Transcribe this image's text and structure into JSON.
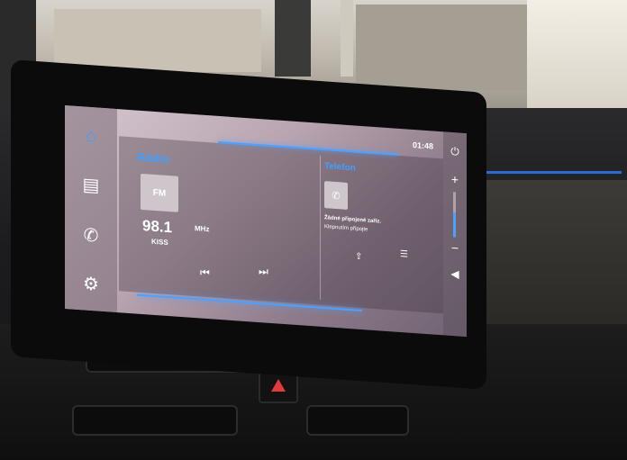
{
  "status": {
    "time": "01:48"
  },
  "sidebar": {
    "items": [
      {
        "icon": "home-icon",
        "glyph": "⌂"
      },
      {
        "icon": "radio-icon",
        "glyph": "▤"
      },
      {
        "icon": "phone-icon",
        "glyph": "✆"
      },
      {
        "icon": "settings-icon",
        "glyph": "⚙"
      }
    ]
  },
  "radio": {
    "title": "Rádio",
    "band": "FM",
    "frequency": "98.1",
    "unit": "MHz",
    "station": "KISS",
    "prev_glyph": "⏮",
    "next_glyph": "⏭"
  },
  "phone": {
    "title": "Telefon",
    "status": "Žádné připojené zaříz.",
    "hint": "Klepnutím připojte",
    "phone_glyph": "✆",
    "action1_glyph": "⇪",
    "action2_glyph": "☰"
  },
  "right_controls": {
    "power_glyph": "⏻",
    "plus_glyph": "+",
    "minus_glyph": "−",
    "mute_glyph": "◀",
    "volume_level": 0.55
  },
  "colors": {
    "accent": "#3fa0ff",
    "hazard": "#e23b3b"
  }
}
